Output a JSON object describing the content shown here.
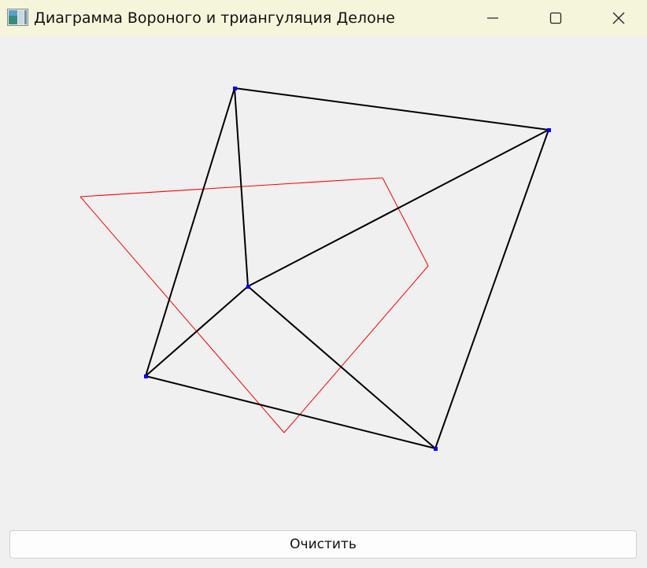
{
  "window": {
    "title": "Диаграмма Вороного и триангуляция Делоне",
    "titlebar_color": "#f5f5dc",
    "icons": {
      "app": "app-icon",
      "minimize": "minimize-icon",
      "maximize": "maximize-icon",
      "close": "close-icon"
    }
  },
  "canvas": {
    "background": "#f0f0f0",
    "colors": {
      "delaunay_edge": "#000000",
      "voronoi_edge": "#ff0000",
      "site_point": "#0000ff"
    }
  },
  "buttons": {
    "clear_label": "Очистить"
  }
}
